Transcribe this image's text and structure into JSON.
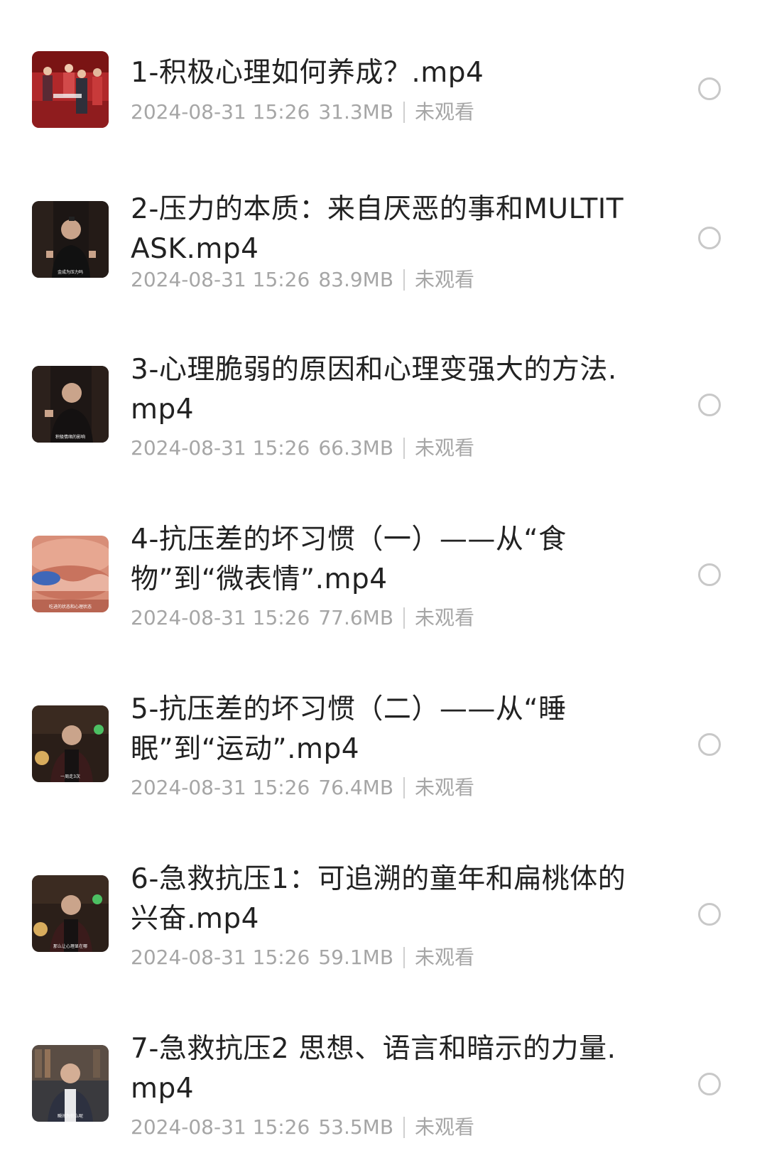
{
  "files": [
    {
      "name": "1-积极心理如何养成？.mp4",
      "date": "2024-08-31 15:26",
      "size": "31.3MB",
      "status": "未观看",
      "thumb_caption": ""
    },
    {
      "name": "2-压力的本质：来自厌恶的事和MULTITASK.mp4",
      "date": "2024-08-31 15:26",
      "size": "83.9MB",
      "status": "未观看",
      "thumb_caption": "金成为压力吗"
    },
    {
      "name": "3-心理脆弱的原因和心理变强大的方法.mp4",
      "date": "2024-08-31 15:26",
      "size": "66.3MB",
      "status": "未观看",
      "thumb_caption": "积极情绪的影响"
    },
    {
      "name": "4-抗压差的坏习惯（一）——从“食物”到“微表情”.mp4",
      "date": "2024-08-31 15:26",
      "size": "77.6MB",
      "status": "未观看",
      "thumb_caption": "吃进的状态和心理状态"
    },
    {
      "name": "5-抗压差的坏习惯（二）——从“睡眠”到“运动”.mp4",
      "date": "2024-08-31 15:26",
      "size": "76.4MB",
      "status": "未观看",
      "thumb_caption": "一周走3次"
    },
    {
      "name": "6-急救抗压1：可追溯的童年和扁桃体的兴奋.mp4",
      "date": "2024-08-31 15:26",
      "size": "59.1MB",
      "status": "未观看",
      "thumb_caption": "那么让心理显在哪"
    },
    {
      "name": "7-急救抗压2 思想、语言和暗示的力量.mp4",
      "date": "2024-08-31 15:26",
      "size": "53.5MB",
      "status": "未观看",
      "thumb_caption": "瞬间为什么呢"
    }
  ]
}
